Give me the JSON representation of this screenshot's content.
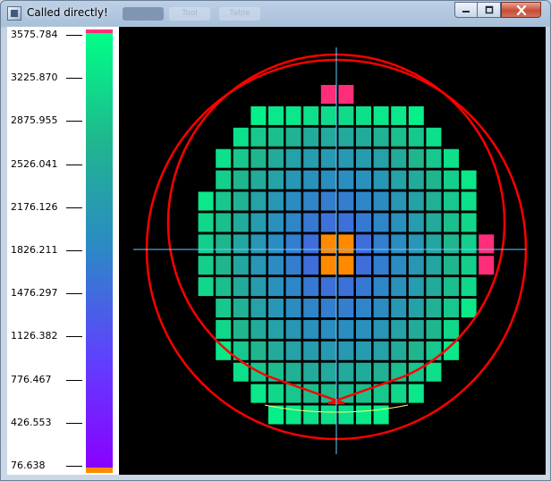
{
  "window": {
    "title": "Called directly!",
    "ghost_tabs": [
      "",
      "Tool",
      "Table"
    ]
  },
  "icons": {
    "app": "app-window-icon",
    "minimize": "minimize-icon",
    "maximize": "maximize-icon",
    "close": "close-icon"
  },
  "colorbar": {
    "ticks": [
      "3575.784",
      "3225.870",
      "2875.955",
      "2526.041",
      "2176.126",
      "1826.211",
      "1476.297",
      "1126.382",
      "776.467",
      "426.553",
      "76.638"
    ],
    "min": 76.638,
    "max": 3575.784,
    "gradient_colors": [
      "#8a00ff",
      "#6040ff",
      "#2c88c7",
      "#1fb68e",
      "#00ff88"
    ],
    "over_color": "#ff2d7a",
    "under_color": "#ff8a00"
  },
  "wafer": {
    "grid_columns": 18,
    "grid_rows": 18,
    "die_values_row_major": [
      [
        0,
        0,
        0,
        0,
        0,
        0,
        0,
        0,
        3590,
        3590,
        0,
        0,
        0,
        0,
        0,
        0,
        0,
        0
      ],
      [
        0,
        0,
        0,
        0,
        3400,
        3300,
        3300,
        3200,
        3150,
        3150,
        3200,
        3300,
        3300,
        3400,
        0,
        0,
        0,
        0
      ],
      [
        0,
        0,
        0,
        3200,
        2900,
        2800,
        2600,
        2500,
        2450,
        2450,
        2500,
        2600,
        2800,
        2900,
        3200,
        0,
        0,
        0
      ],
      [
        0,
        0,
        3200,
        2900,
        2700,
        2500,
        2300,
        2200,
        2150,
        2150,
        2200,
        2300,
        2500,
        2700,
        2900,
        3200,
        0,
        0
      ],
      [
        0,
        0,
        3000,
        2700,
        2500,
        2300,
        2100,
        2000,
        1950,
        1950,
        2000,
        2100,
        2300,
        2500,
        2700,
        3000,
        3300,
        0
      ],
      [
        0,
        3300,
        2900,
        2600,
        2300,
        2100,
        1900,
        1800,
        1700,
        1700,
        1800,
        1900,
        2100,
        2300,
        2600,
        2900,
        3200,
        0
      ],
      [
        0,
        3100,
        2800,
        2500,
        2200,
        2000,
        1800,
        1650,
        1550,
        1550,
        1650,
        1800,
        2000,
        2200,
        2500,
        2800,
        3100,
        0
      ],
      [
        0,
        3000,
        2700,
        2400,
        2100,
        1900,
        1700,
        1500,
        60,
        60,
        1500,
        1700,
        1900,
        2100,
        2400,
        2700,
        3000,
        3590
      ],
      [
        0,
        3000,
        2700,
        2400,
        2100,
        1900,
        1700,
        1500,
        60,
        60,
        1500,
        1700,
        1900,
        2100,
        2400,
        2700,
        3000,
        3590
      ],
      [
        0,
        3100,
        2800,
        2500,
        2200,
        2000,
        1800,
        1650,
        1550,
        1550,
        1650,
        1800,
        2000,
        2200,
        2500,
        2800,
        3100,
        0
      ],
      [
        0,
        0,
        2900,
        2600,
        2300,
        2100,
        1900,
        1800,
        1700,
        1700,
        1800,
        1900,
        2100,
        2300,
        2600,
        2900,
        3300,
        0
      ],
      [
        0,
        0,
        3100,
        2700,
        2500,
        2300,
        2100,
        2000,
        1950,
        1950,
        2000,
        2100,
        2300,
        2500,
        2700,
        3100,
        0,
        0
      ],
      [
        0,
        0,
        3300,
        2900,
        2700,
        2500,
        2300,
        2200,
        2150,
        2150,
        2200,
        2300,
        2500,
        2700,
        2900,
        3300,
        0,
        0
      ],
      [
        0,
        0,
        0,
        3200,
        2900,
        2800,
        2600,
        2500,
        2450,
        2450,
        2500,
        2600,
        2800,
        2900,
        3200,
        0,
        0,
        0
      ],
      [
        0,
        0,
        0,
        0,
        3300,
        3100,
        2900,
        2800,
        2750,
        2750,
        2800,
        2900,
        3100,
        3300,
        0,
        0,
        0,
        0
      ],
      [
        0,
        0,
        0,
        0,
        0,
        3400,
        3300,
        3200,
        3200,
        3200,
        3300,
        3400,
        0,
        0,
        0,
        0,
        0,
        0
      ]
    ],
    "ring_color": "#ff0000",
    "flat_arc_color": "#ffff66",
    "crosshair_color": "#66ccff",
    "background": "#000000"
  }
}
